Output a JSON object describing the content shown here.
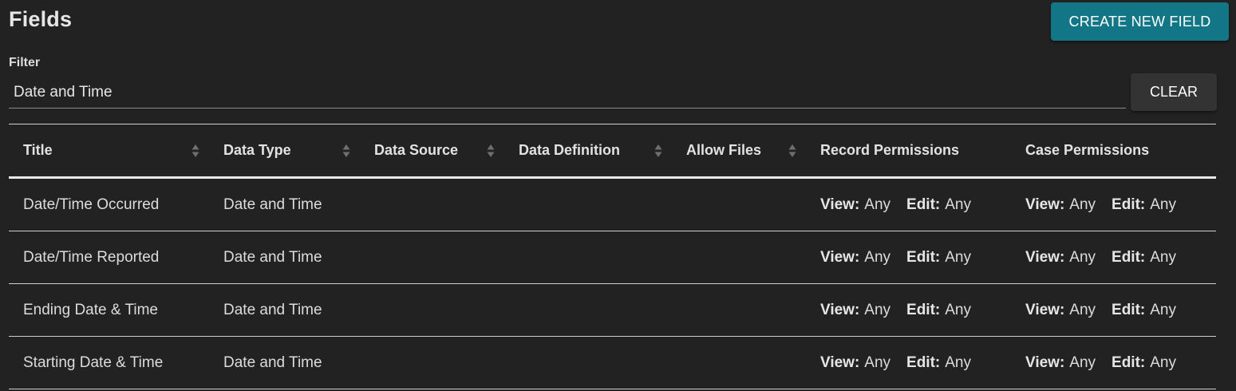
{
  "page": {
    "title": "Fields",
    "create_button": "CREATE NEW FIELD"
  },
  "filter": {
    "label": "Filter",
    "value": "Date and Time",
    "clear_button": "CLEAR"
  },
  "table": {
    "columns": [
      {
        "label": "Title",
        "sortable": true
      },
      {
        "label": "Data Type",
        "sortable": true
      },
      {
        "label": "Data Source",
        "sortable": true
      },
      {
        "label": "Data Definition",
        "sortable": true
      },
      {
        "label": "Allow Files",
        "sortable": true
      },
      {
        "label": "Record Permissions",
        "sortable": false
      },
      {
        "label": "Case Permissions",
        "sortable": false
      }
    ],
    "perm_labels": {
      "view": "View:",
      "edit": "Edit:"
    },
    "rows": [
      {
        "title": "Date/Time Occurred",
        "data_type": "Date and Time",
        "data_source": "",
        "data_definition": "",
        "allow_files": "",
        "record_view": "Any",
        "record_edit": "Any",
        "case_view": "Any",
        "case_edit": "Any"
      },
      {
        "title": "Date/Time Reported",
        "data_type": "Date and Time",
        "data_source": "",
        "data_definition": "",
        "allow_files": "",
        "record_view": "Any",
        "record_edit": "Any",
        "case_view": "Any",
        "case_edit": "Any"
      },
      {
        "title": "Ending Date & Time",
        "data_type": "Date and Time",
        "data_source": "",
        "data_definition": "",
        "allow_files": "",
        "record_view": "Any",
        "record_edit": "Any",
        "case_view": "Any",
        "case_edit": "Any"
      },
      {
        "title": "Starting Date & Time",
        "data_type": "Date and Time",
        "data_source": "",
        "data_definition": "",
        "allow_files": "",
        "record_view": "Any",
        "record_edit": "Any",
        "case_view": "Any",
        "case_edit": "Any"
      }
    ]
  },
  "colors": {
    "background": "#222222",
    "accent": "#137686",
    "secondary_button": "#333333"
  },
  "icons": {
    "sort": "sort-both-icon"
  }
}
